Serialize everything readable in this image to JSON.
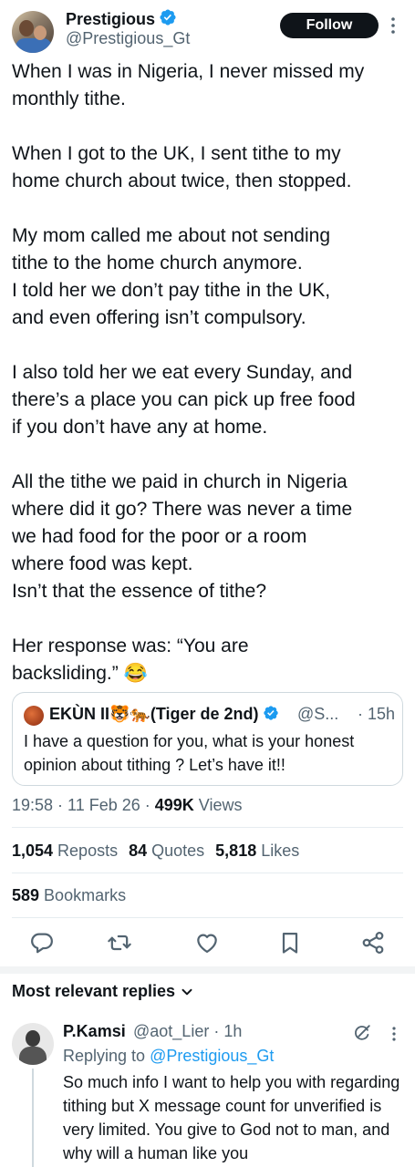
{
  "author": {
    "display_name": "Prestigious",
    "handle": "@Prestigious_Gt",
    "follow_label": "Follow"
  },
  "tweet": {
    "paragraphs": [
      "When I was in Nigeria, I never missed my\nmonthly tithe.",
      "When I got to the UK, I sent tithe to my\nhome church about twice, then stopped.",
      "My mom called me about not sending\ntithe to the home church anymore.\nI told her we don’t pay tithe in the UK,\nand even offering isn’t compulsory.",
      "I also told her we eat every Sunday, and\nthere’s a place you can pick up free food\nif you don’t have any at home.",
      "All the tithe we paid in church in Nigeria\nwhere did it go? There was never a time\nwe had food for the poor or a room\nwhere food was kept.\nIsn’t that the essence of tithe?",
      "Her response was: “You are\nbacksliding.” 😂"
    ]
  },
  "quote": {
    "name": "EKÙN II🐯🐅(Tiger de 2nd)",
    "handle": "@S...",
    "time": "· 15h",
    "text": "I have a question for you, what is your honest opinion about tithing ? Let’s have it!!"
  },
  "meta": {
    "time_date": "19:58 · 11 Feb 26 · ",
    "views_count": "499K",
    "views_label": " Views"
  },
  "stats": {
    "reposts_count": "1,054",
    "reposts_label": " Reposts",
    "quotes_count": "84",
    "quotes_label": " Quotes",
    "likes_count": "5,818",
    "likes_label": " Likes",
    "bookmarks_count": "589",
    "bookmarks_label": " Bookmarks"
  },
  "actions": [
    "reply-icon",
    "repost-icon",
    "like-icon",
    "bookmark-icon",
    "share-icon"
  ],
  "replies_header": "Most relevant replies",
  "reply": {
    "name": "P.Kamsi",
    "handle": "@aot_Lier · 1h",
    "replying_prefix": "Replying to ",
    "replying_to": "@Prestigious_Gt",
    "text": "So much info I want to help you with regarding tithing but X message count for unverified is very limited. You give to God not to man, and why will a human like you"
  },
  "colors": {
    "text": "#0f1419",
    "secondary": "#536471",
    "accent": "#1d9bf0",
    "border": "#cfd9de"
  }
}
